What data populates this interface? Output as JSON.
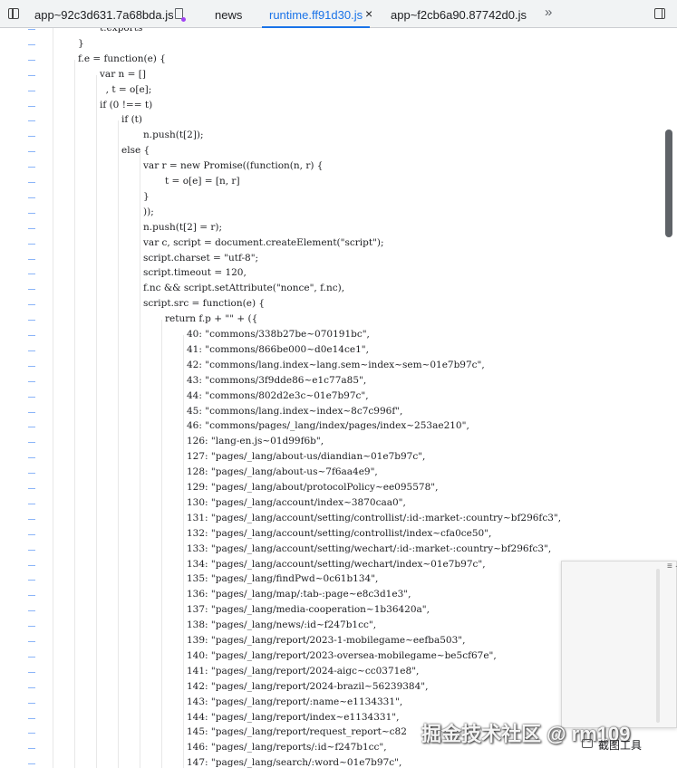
{
  "tabs": [
    {
      "label": "app~92c3d631.7a68bda.js",
      "active": false
    },
    {
      "label": "news",
      "active": false
    },
    {
      "label": "runtime.ff91d30.js",
      "active": true
    },
    {
      "label": "app~f2cb6a90.87742d0.js",
      "active": false
    }
  ],
  "icons": {
    "sidebar": "sidebar-toggle-icon",
    "file": "file-icon",
    "close": "close-icon",
    "more": "more-tabs-icon",
    "panel": "panel-toggle-icon",
    "screenshot": "screenshot-tool-icon"
  },
  "close_glyph": "×",
  "more_glyph": "»",
  "code_lines": [
    {
      "indent": 2,
      "text": "t.exports"
    },
    {
      "indent": 1,
      "text": "}"
    },
    {
      "indent": 1,
      "text": "f.e = function(e) {"
    },
    {
      "indent": 2,
      "text": "var n = []"
    },
    {
      "indent": 2,
      "text": "  , t = o[e];"
    },
    {
      "indent": 2,
      "text": "if (0 !== t)"
    },
    {
      "indent": 3,
      "text": "if (t)"
    },
    {
      "indent": 4,
      "text": "n.push(t[2]);"
    },
    {
      "indent": 3,
      "text": "else {"
    },
    {
      "indent": 4,
      "text": "var r = new Promise((function(n, r) {"
    },
    {
      "indent": 5,
      "text": "t = o[e] = [n, r]"
    },
    {
      "indent": 4,
      "text": "}"
    },
    {
      "indent": 4,
      "text": "));"
    },
    {
      "indent": 4,
      "text": "n.push(t[2] = r);"
    },
    {
      "indent": 4,
      "text": "var c, script = document.createElement(\"script\");"
    },
    {
      "indent": 4,
      "text": "script.charset = \"utf-8\";"
    },
    {
      "indent": 4,
      "text": "script.timeout = 120,"
    },
    {
      "indent": 4,
      "text": "f.nc && script.setAttribute(\"nonce\", f.nc),"
    },
    {
      "indent": 4,
      "text": "script.src = function(e) {"
    },
    {
      "indent": 5,
      "text": "return f.p + \"\" + ({"
    },
    {
      "indent": 6,
      "text": "40: \"commons/338b27be~070191bc\","
    },
    {
      "indent": 6,
      "text": "41: \"commons/866be000~d0e14ce1\","
    },
    {
      "indent": 6,
      "text": "42: \"commons/lang.index~lang.sem~index~sem~01e7b97c\","
    },
    {
      "indent": 6,
      "text": "43: \"commons/3f9dde86~e1c77a85\","
    },
    {
      "indent": 6,
      "text": "44: \"commons/802d2e3c~01e7b97c\","
    },
    {
      "indent": 6,
      "text": "45: \"commons/lang.index~index~8c7c996f\","
    },
    {
      "indent": 6,
      "text": "46: \"commons/pages/_lang/index/pages/index~253ae210\","
    },
    {
      "indent": 6,
      "text": "126: \"lang-en.js~01d99f6b\","
    },
    {
      "indent": 6,
      "text": "127: \"pages/_lang/about-us/diandian~01e7b97c\","
    },
    {
      "indent": 6,
      "text": "128: \"pages/_lang/about-us~7f6aa4e9\","
    },
    {
      "indent": 6,
      "text": "129: \"pages/_lang/about/protocolPolicy~ee095578\","
    },
    {
      "indent": 6,
      "text": "130: \"pages/_lang/account/index~3870caa0\","
    },
    {
      "indent": 6,
      "text": "131: \"pages/_lang/account/setting/controllist/:id-:market-:country~bf296fc3\","
    },
    {
      "indent": 6,
      "text": "132: \"pages/_lang/account/setting/controllist/index~cfa0ce50\","
    },
    {
      "indent": 6,
      "text": "133: \"pages/_lang/account/setting/wechart/:id-:market-:country~bf296fc3\","
    },
    {
      "indent": 6,
      "text": "134: \"pages/_lang/account/setting/wechart/index~01e7b97c\","
    },
    {
      "indent": 6,
      "text": "135: \"pages/_lang/findPwd~0c61b134\","
    },
    {
      "indent": 6,
      "text": "136: \"pages/_lang/map/:tab-:page~e8c3d1e3\","
    },
    {
      "indent": 6,
      "text": "137: \"pages/_lang/media-cooperation~1b36420a\","
    },
    {
      "indent": 6,
      "text": "138: \"pages/_lang/news/:id~f247b1cc\","
    },
    {
      "indent": 6,
      "text": "139: \"pages/_lang/report/2023-1-mobilegame~eefba503\","
    },
    {
      "indent": 6,
      "text": "140: \"pages/_lang/report/2023-oversea-mobilegame~be5cf67e\","
    },
    {
      "indent": 6,
      "text": "141: \"pages/_lang/report/2024-aigc~cc0371e8\","
    },
    {
      "indent": 6,
      "text": "142: \"pages/_lang/report/2024-brazil~56239384\","
    },
    {
      "indent": 6,
      "text": "143: \"pages/_lang/report/:name~e1134331\","
    },
    {
      "indent": 6,
      "text": "144: \"pages/_lang/report/index~e1134331\","
    },
    {
      "indent": 6,
      "text": "145: \"pages/_lang/report/request_report~c82"
    },
    {
      "indent": 6,
      "text": "146: \"pages/_lang/reports/:id~f247b1cc\","
    },
    {
      "indent": 6,
      "text": "147: \"pages/_lang/search/:word~01e7b97c\","
    }
  ],
  "gutter_marker": "–",
  "floating_panel": {
    "label": "≡ ·"
  },
  "watermark": "掘金技术社区 @ rm109",
  "screenshot_tool": "截图工具"
}
